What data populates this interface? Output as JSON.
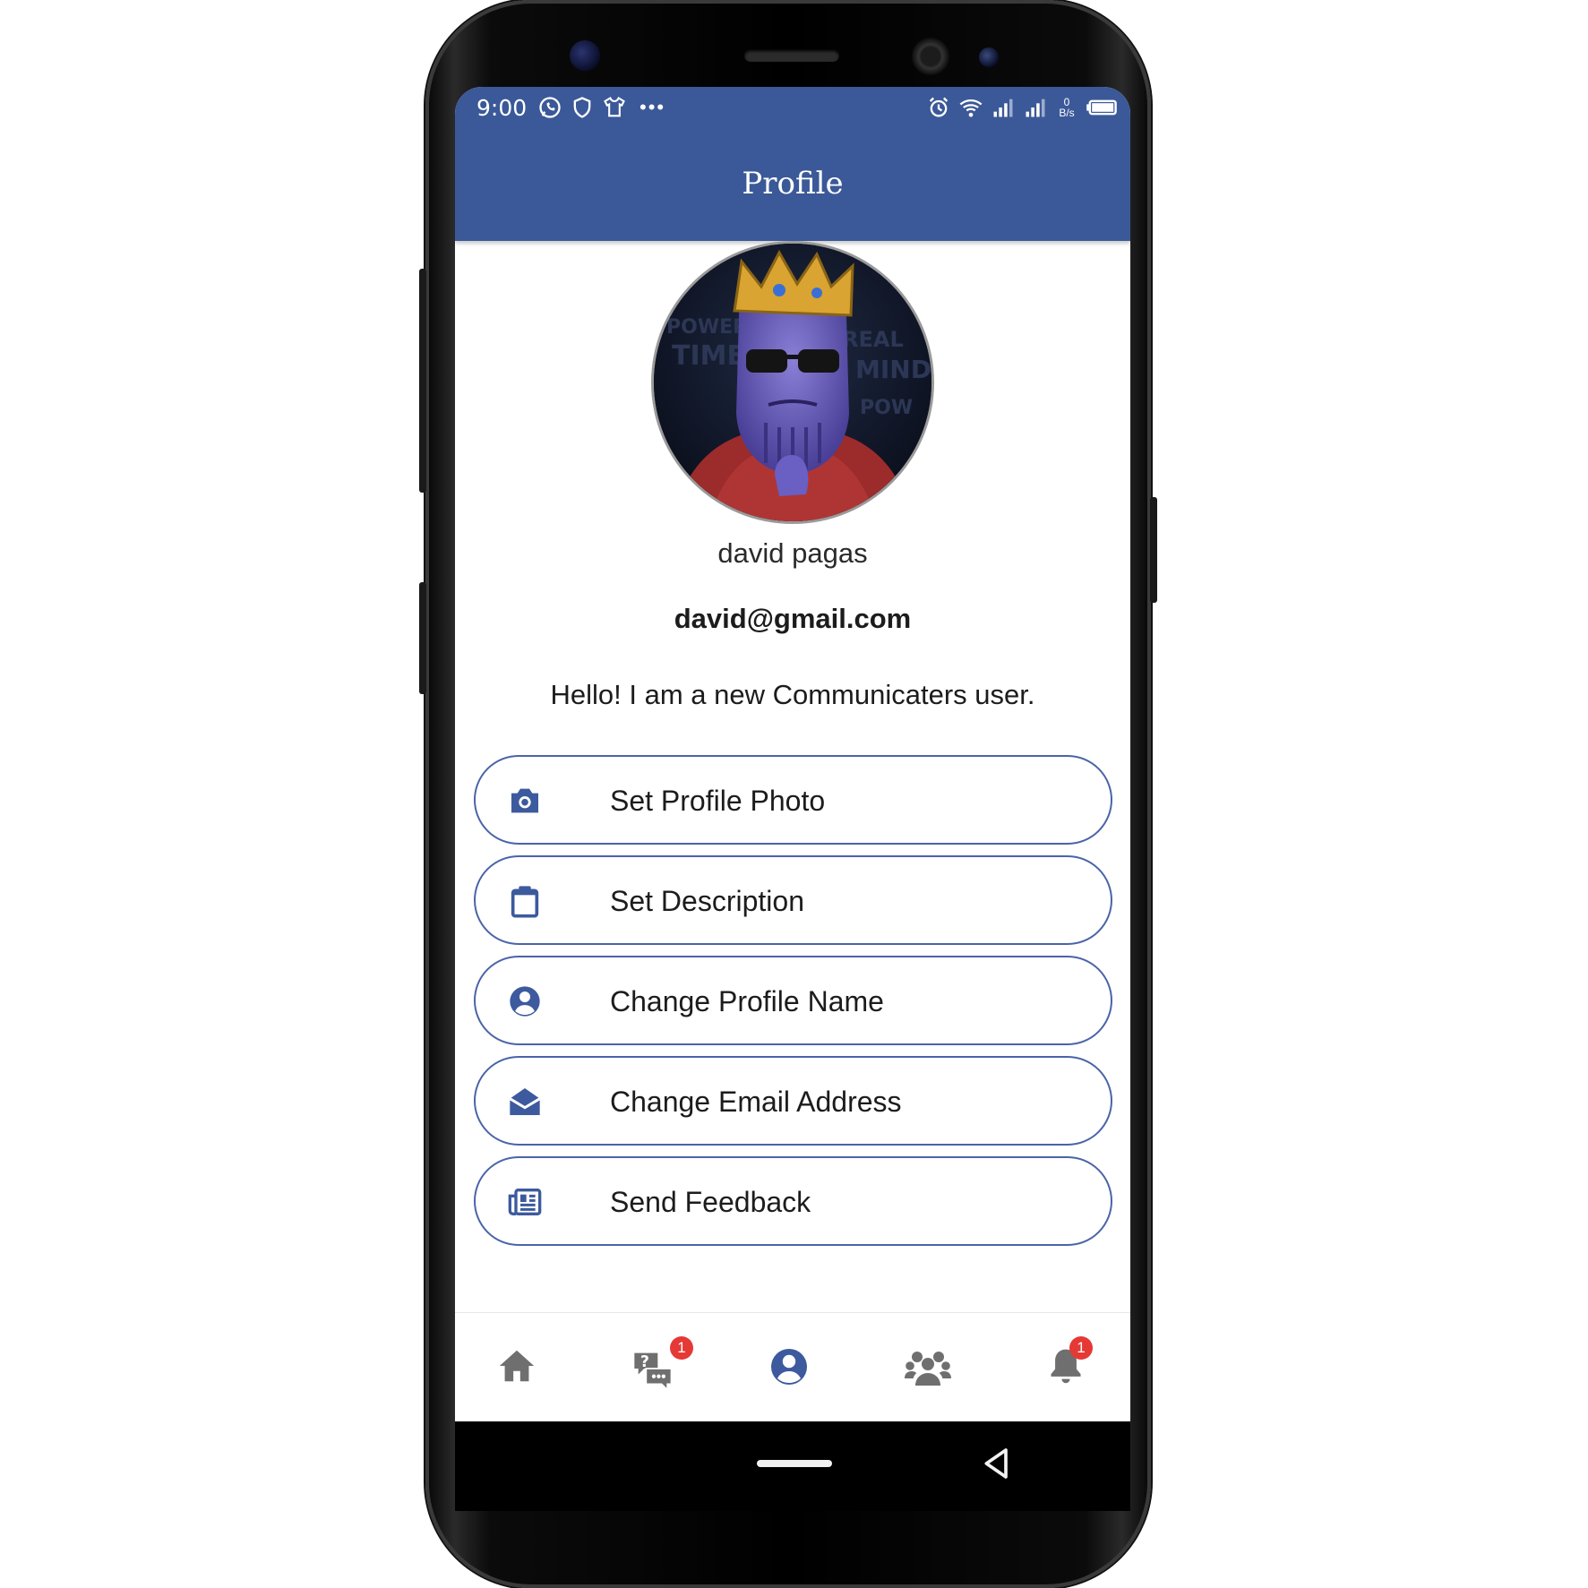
{
  "status_bar": {
    "time": "9:00",
    "left_icons": [
      "whatsapp-icon",
      "shield-icon",
      "shirt-icon"
    ],
    "overflow": "•••",
    "right_icons": [
      "alarm-icon",
      "wifi-icon",
      "signal-icon",
      "signal-icon",
      "data-rate-icon",
      "battery-icon"
    ],
    "data_rate": "0 B/s"
  },
  "appbar": {
    "title": "Profile"
  },
  "profile": {
    "name": "david pagas",
    "email": "david@gmail.com",
    "description": "Hello! I am a new Communicaters user."
  },
  "actions": [
    {
      "label": "Set Profile Photo",
      "icon": "camera-icon"
    },
    {
      "label": "Set Description",
      "icon": "clipboard-icon"
    },
    {
      "label": "Change Profile Name",
      "icon": "user-circle-icon"
    },
    {
      "label": "Change Email Address",
      "icon": "envelope-open-icon"
    },
    {
      "label": "Send Feedback",
      "icon": "newspaper-icon"
    }
  ],
  "bottom_nav": [
    {
      "name": "home",
      "icon": "home-icon",
      "active": false,
      "badge": ""
    },
    {
      "name": "chats",
      "icon": "chat-question-icon",
      "active": false,
      "badge": "1"
    },
    {
      "name": "profile",
      "icon": "user-circle-icon",
      "active": true,
      "badge": ""
    },
    {
      "name": "groups",
      "icon": "users-icon",
      "active": false,
      "badge": ""
    },
    {
      "name": "notifications",
      "icon": "bell-icon",
      "active": false,
      "badge": "1"
    }
  ],
  "colors": {
    "primary": "#3b5998",
    "button_border": "#4a64a8",
    "icon_blue": "#3d5a9e",
    "icon_gray": "#6f6f6f",
    "badge": "#e53935"
  }
}
